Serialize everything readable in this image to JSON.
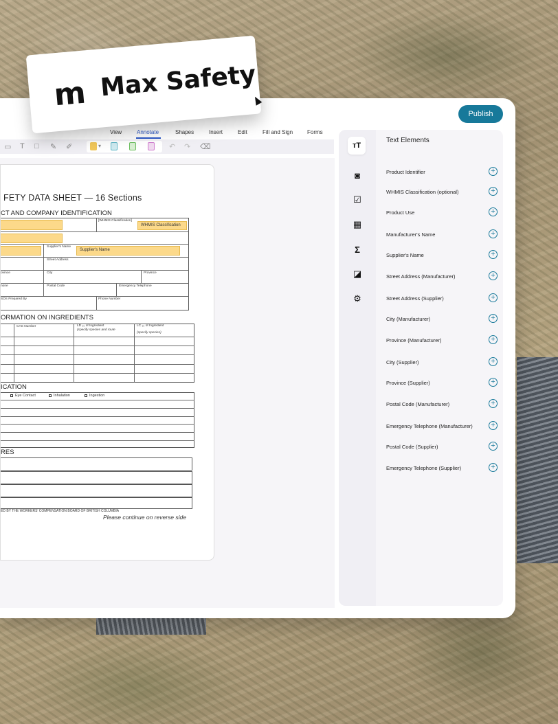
{
  "brand": {
    "name": "Max Safety",
    "mark": "m"
  },
  "header": {
    "publish_label": "Publish"
  },
  "menu": [
    "View",
    "Annotate",
    "Shapes",
    "Insert",
    "Edit",
    "Fill and Sign",
    "Forms"
  ],
  "menu_active": "Annotate",
  "toolbar": {
    "text_tool": "T"
  },
  "document": {
    "title": "FETY DATA SHEET — 16 Sections",
    "section1": "CT AND COMPANY IDENTIFICATION",
    "whmis_label": "[WHMIS Classification]",
    "whmis_fill": "WHMIS Classification",
    "supplier_label": "Supplier's Name",
    "supplier_fill": "Supplier's Name",
    "street_label": "Street Address",
    "province_a": "ovince",
    "city_label": "City",
    "province_label": "Province",
    "phone_a": "none",
    "postal_label": "Postal Code",
    "emergency_label": "Emergency Telephone",
    "prepared_label": "SDS Prepared By",
    "phone_label": "Phone Number",
    "section2": "ORMATION ON INGREDIENTS",
    "cas_label": "CAS Number",
    "ld_label": "LD ₅₀ of Ingredient",
    "ld_sub": "(specify species and route",
    "lc_label": "LC ₅₀ of Ingredient",
    "lc_sub": "(specify species)",
    "section3": "ICATION",
    "eye_contact": "Eye Contact",
    "inhalation": "Inhalation",
    "ingestion": "Ingestion",
    "section4": "RES",
    "footer": "ED BY THE WORKERS' COMPENSATION BOARD OF BRITISH COLUMBIA",
    "continue": "Please continue on reverse side"
  },
  "panel": {
    "heading": "Text Elements",
    "rail_icons": [
      "text-size-icon",
      "camera-icon",
      "checkbox-icon",
      "table-icon",
      "sigma-icon",
      "reader-icon",
      "gear-icon"
    ],
    "items": [
      "Product Identifier",
      "WHMIS Classification (optional)",
      "Product Use",
      "Manufacturer's Name",
      "Supplier's Name",
      "Street Address (Manufacturer)",
      "Street Address (Supplier)",
      "City (Manufacturer)",
      "Province (Manufacturer)",
      "City (Supplier)",
      "Province (Supplier)",
      "Postal Code (Manufacturer)",
      "Emergency Telephone (Manufacturer)",
      "Postal Code (Supplier)",
      "Emergency Telephone (Supplier)"
    ]
  },
  "colors": {
    "accent": "#17799a",
    "highlight": "#fcd98a",
    "menu_active": "#2a56c6"
  }
}
